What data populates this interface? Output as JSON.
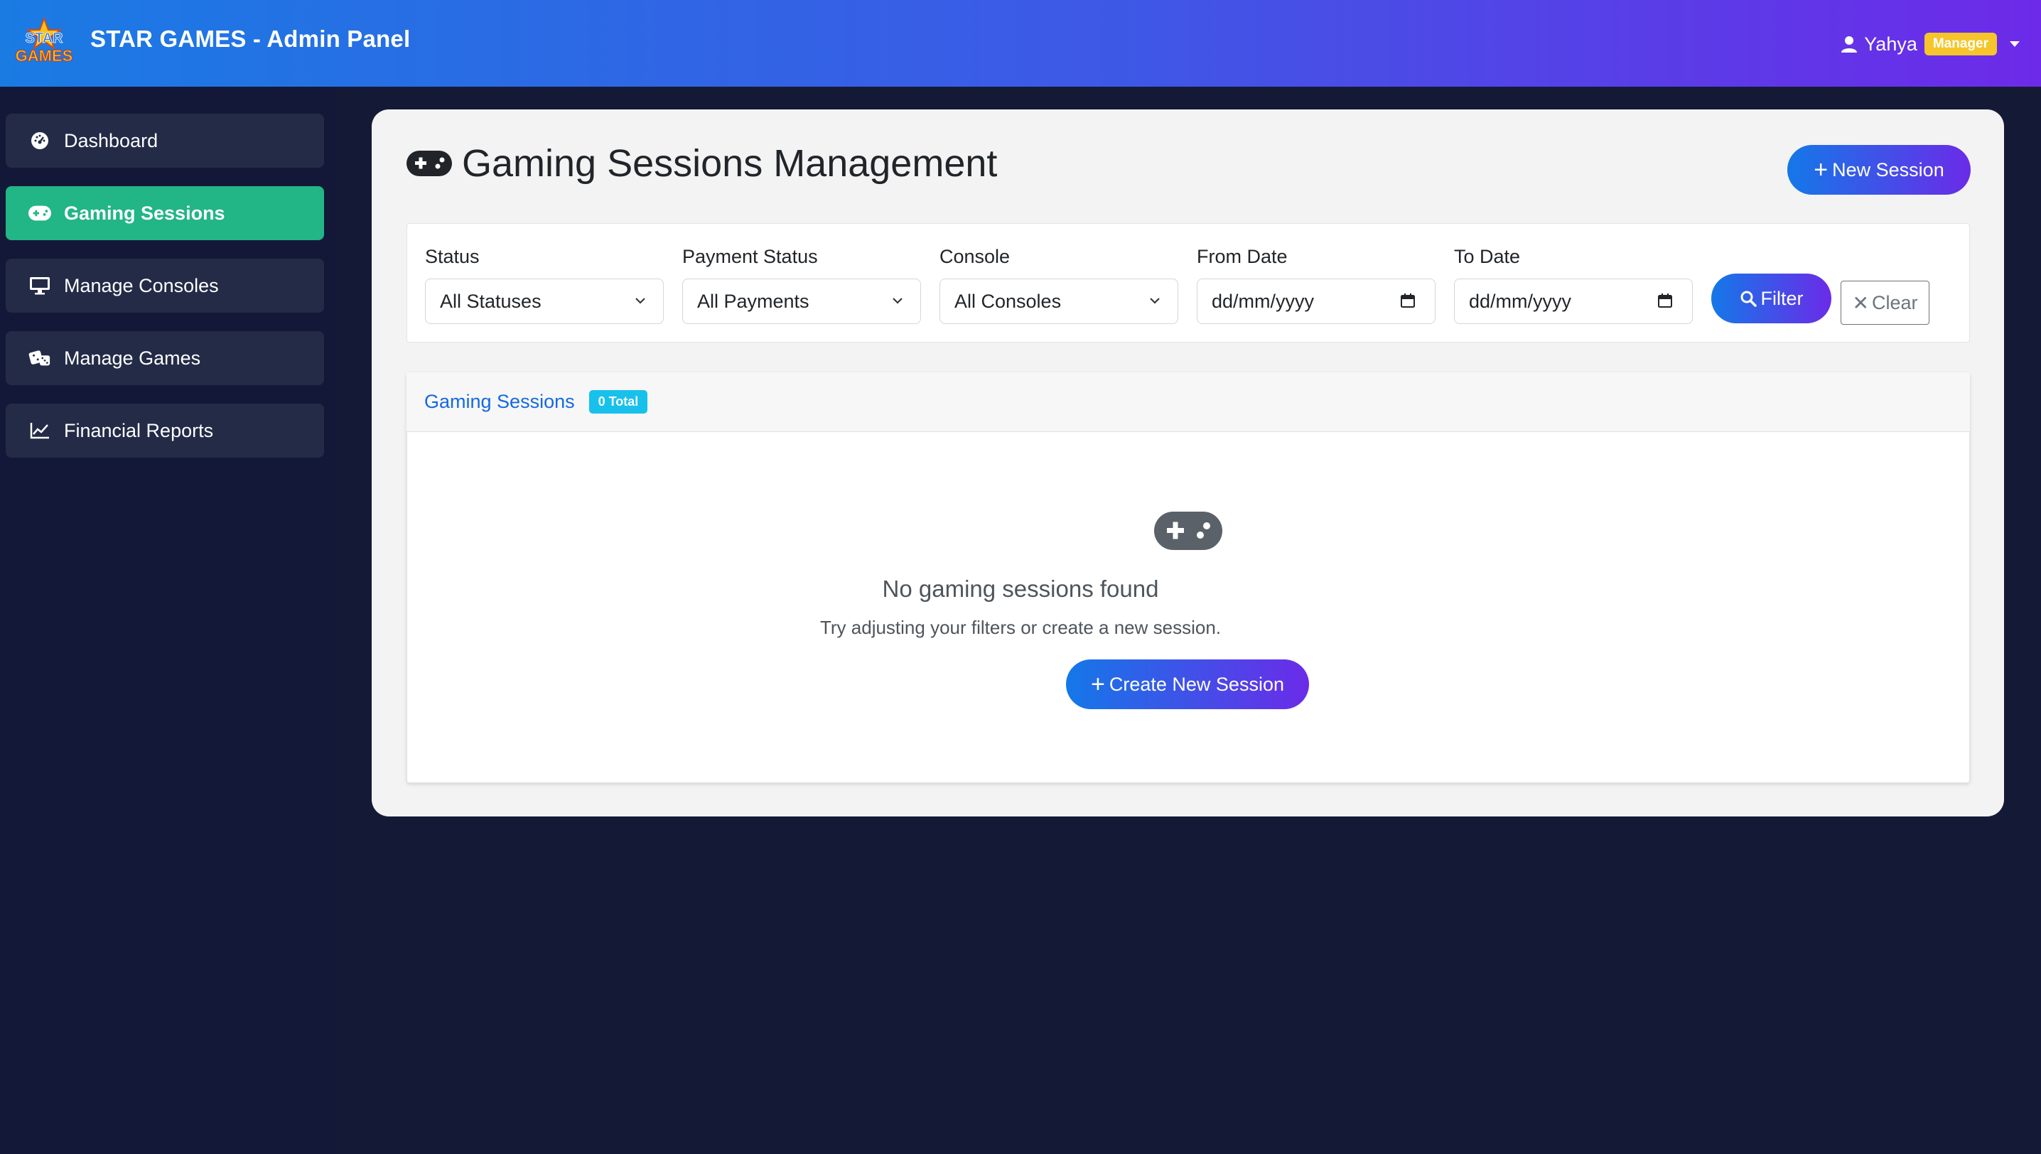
{
  "header": {
    "logo_text": "STAR GAMES",
    "title": "STAR GAMES - Admin Panel",
    "user": {
      "name": "Yahya",
      "role": "Manager",
      "icon": "user-icon"
    }
  },
  "sidebar": {
    "items": [
      {
        "label": "Dashboard",
        "icon": "tachometer-icon",
        "active": false
      },
      {
        "label": "Gaming Sessions",
        "icon": "gamepad-icon",
        "active": true
      },
      {
        "label": "Manage Consoles",
        "icon": "monitor-icon",
        "active": false
      },
      {
        "label": "Manage Games",
        "icon": "dice-icon",
        "active": false
      },
      {
        "label": "Financial Reports",
        "icon": "chart-line-icon",
        "active": false
      }
    ]
  },
  "main": {
    "title": "Gaming Sessions Management",
    "new_session_label": "New Session",
    "filters": {
      "status": {
        "label": "Status",
        "value": "All Statuses"
      },
      "payment": {
        "label": "Payment Status",
        "value": "All Payments"
      },
      "console": {
        "label": "Console",
        "value": "All Consoles"
      },
      "from_date": {
        "label": "From Date",
        "value": "dd/mm/yyyy"
      },
      "to_date": {
        "label": "To Date",
        "value": "dd/mm/yyyy"
      },
      "filter_label": "Filter",
      "clear_label": "Clear"
    },
    "sessions": {
      "title": "Gaming Sessions",
      "count_badge": "0 Total",
      "empty_title": "No gaming sessions found",
      "empty_subtitle": "Try adjusting your filters or create a new session.",
      "create_label": "Create New Session"
    }
  },
  "colors": {
    "accent_start": "#1478e8",
    "accent_end": "#6b2be8",
    "active_sidebar": "#22b585",
    "badge_manager": "#f5c52b",
    "badge_count": "#17c1ec"
  }
}
